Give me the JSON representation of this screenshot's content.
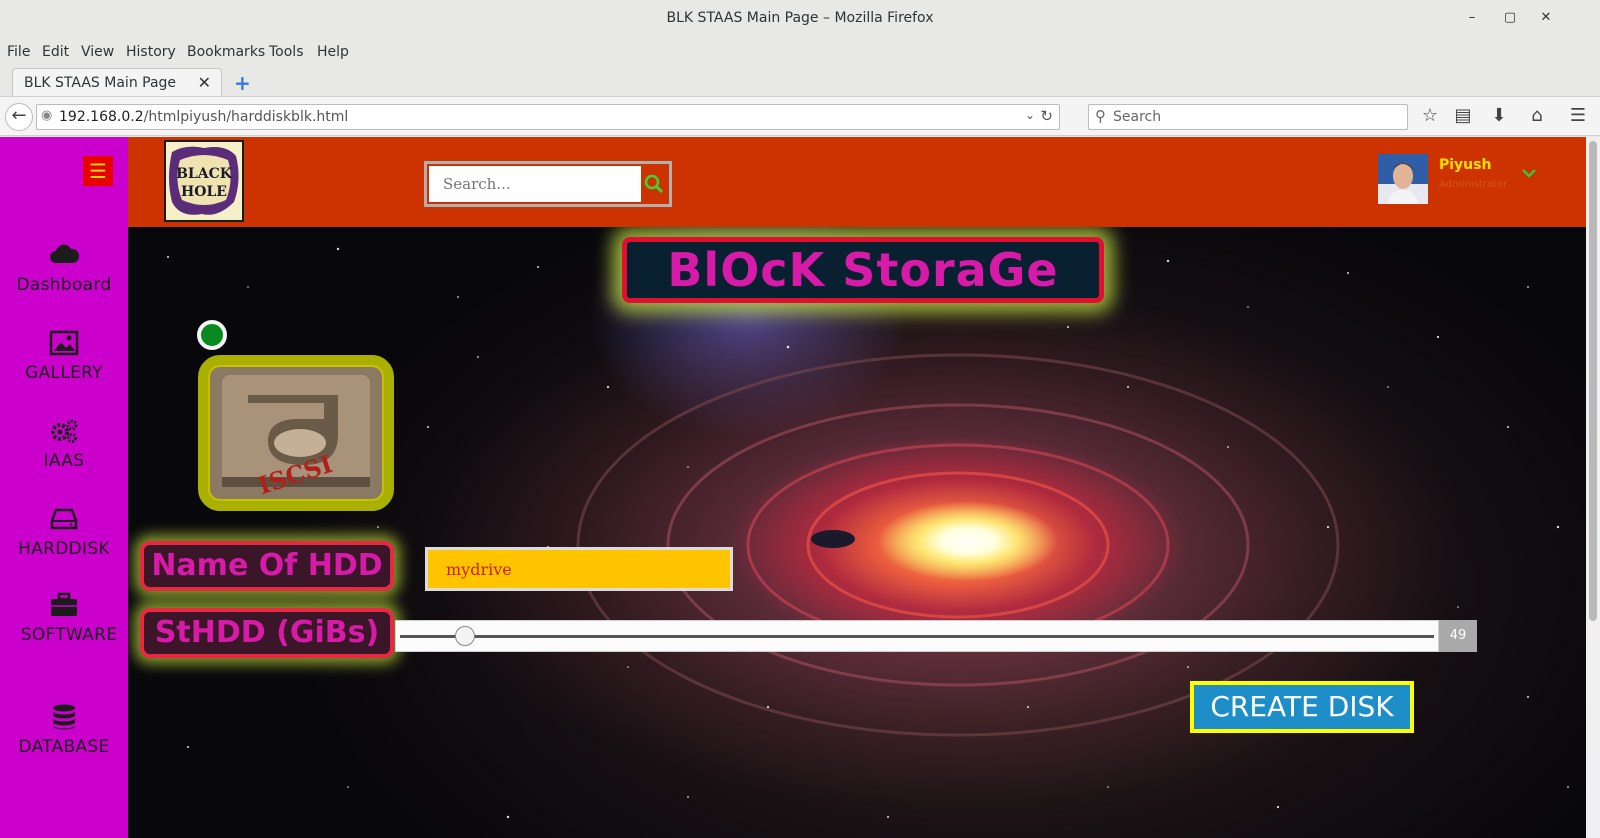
{
  "window": {
    "title": "BLK STAAS Main Page – Mozilla Firefox"
  },
  "menu": [
    {
      "label": "File"
    },
    {
      "label": "Edit"
    },
    {
      "label": "View"
    },
    {
      "label": "History"
    },
    {
      "label": "Bookmarks"
    },
    {
      "label": "Tools"
    },
    {
      "label": "Help"
    }
  ],
  "tab": {
    "label": "BLK STAAS Main Page"
  },
  "address": {
    "host": "192.168.0.2",
    "path": "/htmlpiyush/harddiskblk.html"
  },
  "browser_search": {
    "placeholder": "Search"
  },
  "sidebar": {
    "items": [
      {
        "label": "Dashboard",
        "icon": "cloud-icon"
      },
      {
        "label": "GALLERY",
        "icon": "image-icon"
      },
      {
        "label": "IAAS",
        "icon": "gears-icon"
      },
      {
        "label": "HARDDISK",
        "icon": "harddisk-icon"
      },
      {
        "label": "SOFTWARE",
        "icon": "briefcase-icon"
      },
      {
        "label": "DATABASE",
        "icon": "database-icon"
      }
    ]
  },
  "header": {
    "logo_text": [
      "BLACK",
      "HOLE"
    ],
    "search_placeholder": "Search...",
    "user": {
      "name": "Piyush",
      "role": "Administrator"
    }
  },
  "main": {
    "title": "BlOcK StoraGe",
    "icon_text": "ISCSI",
    "name_label": "Name Of HDD",
    "name_value": "mydrive",
    "size_label": "StHDD (GiBs)",
    "size_value": "49",
    "size_fraction": 0.054,
    "create_label": "CREATE DISK"
  },
  "colors": {
    "sidebar": "#cc00cc",
    "topbar": "#cc3300",
    "accent_yellow": "#ffc400",
    "heading_text": "#d81aa8",
    "create_button": "#1e8ec8"
  }
}
